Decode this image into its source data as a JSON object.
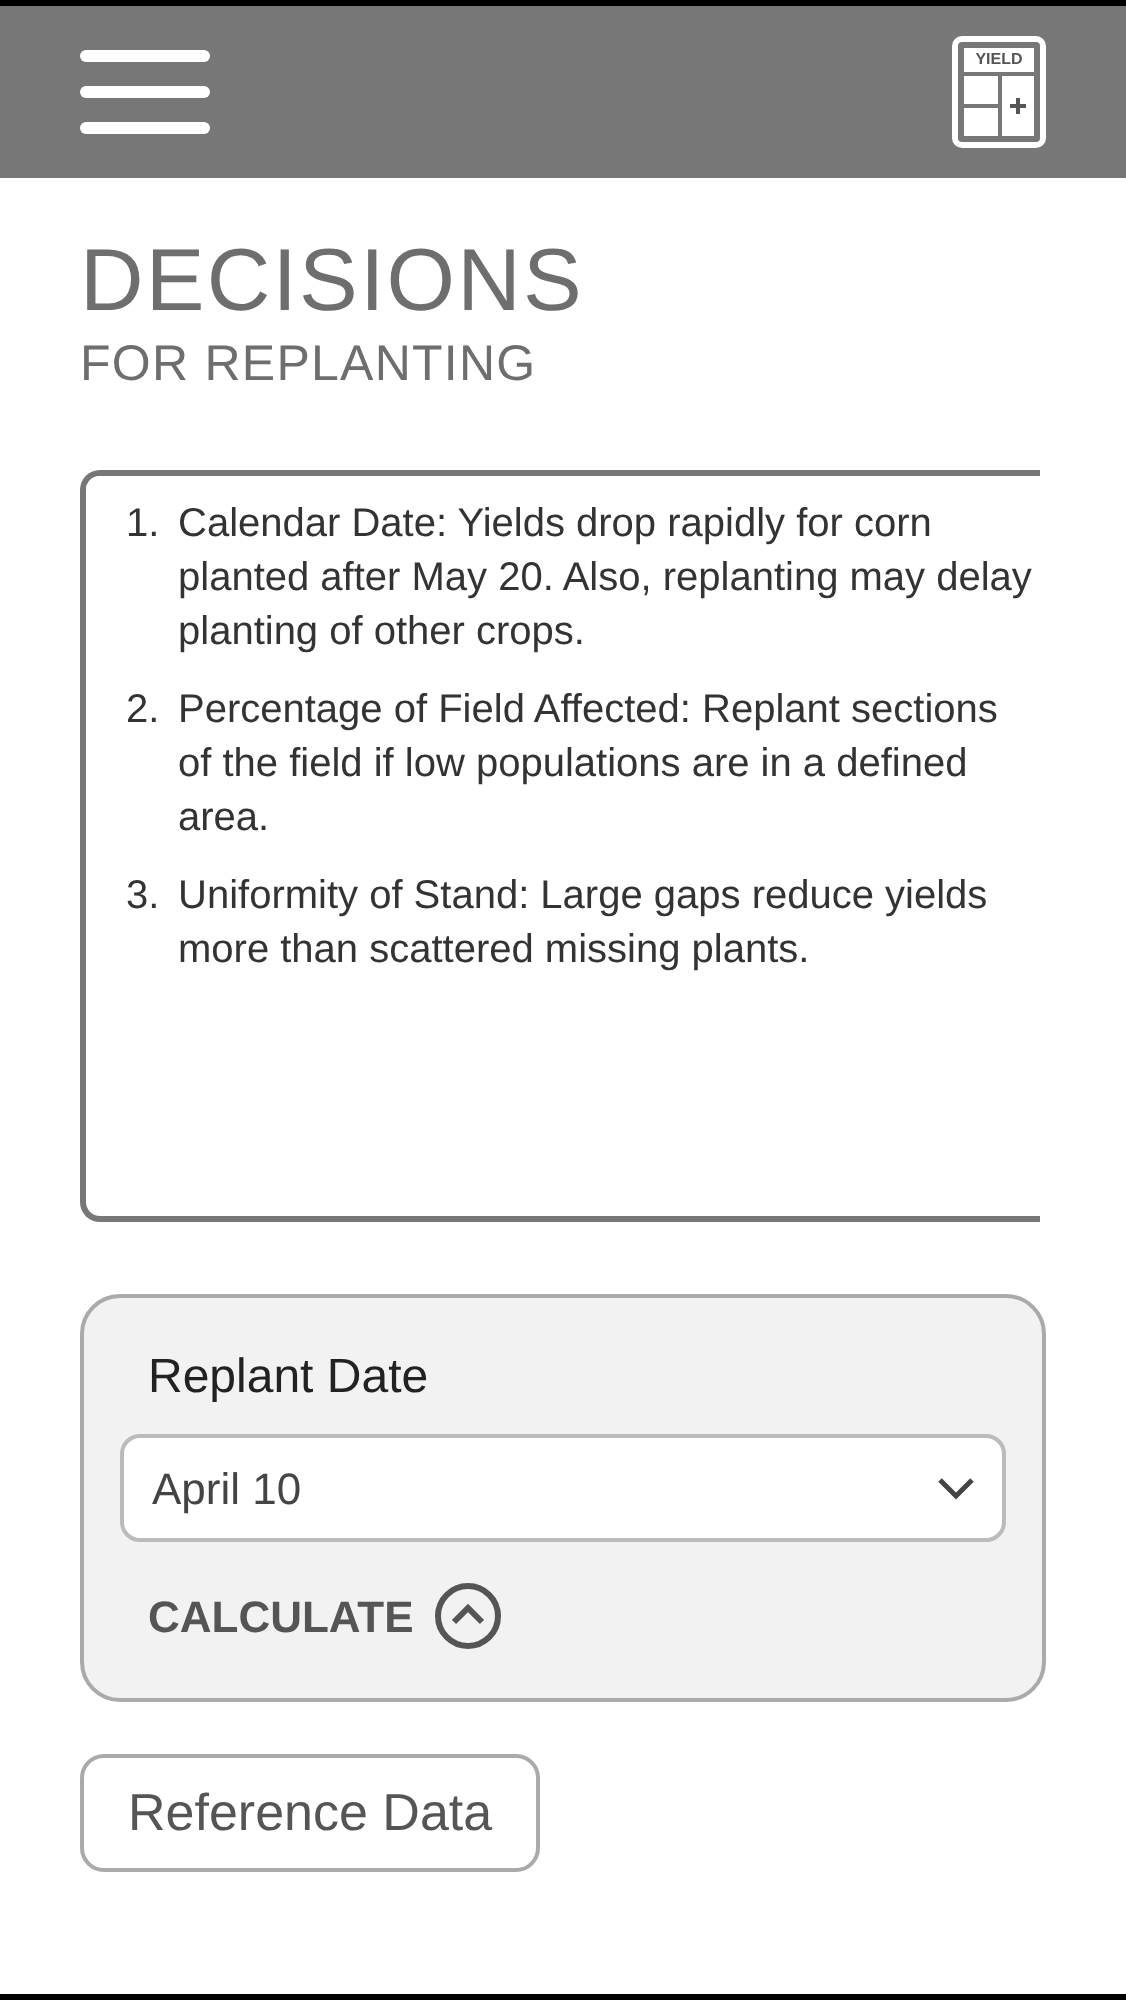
{
  "header": {
    "calculator_label": "YIELD"
  },
  "title": "DECISIONS",
  "subtitle": "FOR REPLANTING",
  "factors": [
    {
      "number": "1.",
      "text": "Calendar Date: Yields drop rapidly for corn planted after May 20.  Also, replanting may delay planting of other crops."
    },
    {
      "number": "2.",
      "text": "Percentage of Field Affected: Replant sections of the field if low populations are in a defined area."
    },
    {
      "number": "3.",
      "text": "Uniformity of Stand: Large gaps reduce yields more than scattered missing plants."
    }
  ],
  "calculator": {
    "label": "Replant Date",
    "value": "April 10",
    "action": "CALCULATE"
  },
  "reference_button": "Reference Data"
}
